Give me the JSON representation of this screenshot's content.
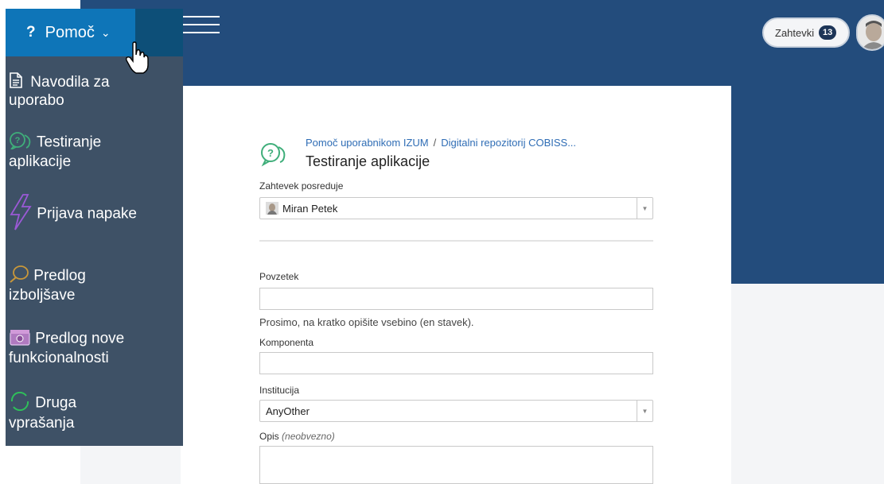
{
  "header": {
    "requests_label": "Zahtevki",
    "requests_count": "13"
  },
  "help_menu": {
    "label": "Pomoč",
    "items": [
      {
        "label_line1": "Navodila za",
        "label_line2": "uporabo",
        "icon": "document-icon"
      },
      {
        "label_line1": "Testiranje",
        "label_line2": "aplikacije",
        "icon": "question-bubble-icon"
      },
      {
        "label_line1": "Prijava napake",
        "label_line2": "",
        "icon": "lightning-icon"
      },
      {
        "label_line1": "Predlog",
        "label_line2": "izboljšave",
        "icon": "lightbulb-icon"
      },
      {
        "label_line1": "Predlog nove",
        "label_line2": "funkcionalnosti",
        "icon": "gift-icon"
      },
      {
        "label_line1": "Druga",
        "label_line2": "vprašanja",
        "icon": "refresh-circle-icon"
      }
    ]
  },
  "form": {
    "breadcrumb": [
      "Pomoč uporabnikom IZUM",
      "Digitalni repozitorij COBISS..."
    ],
    "breadcrumb_sep": "/",
    "title": "Testiranje aplikacije",
    "requester_label": "Zahtevek posreduje",
    "requester_value": "Miran Petek",
    "summary_label": "Povzetek",
    "summary_value": "",
    "summary_hint": "Prosimo, na kratko opišite vsebino (en stavek).",
    "component_label": "Komponenta",
    "component_value": "",
    "institution_label": "Institucija",
    "institution_value": "AnyOther",
    "description_label": "Opis",
    "description_optional": "(neobvezno)",
    "description_value": ""
  },
  "colors": {
    "header_bg": "#234c7c",
    "help_button": "#0e75b8",
    "menu_bg": "#3e5166",
    "link": "#2f6db5"
  }
}
